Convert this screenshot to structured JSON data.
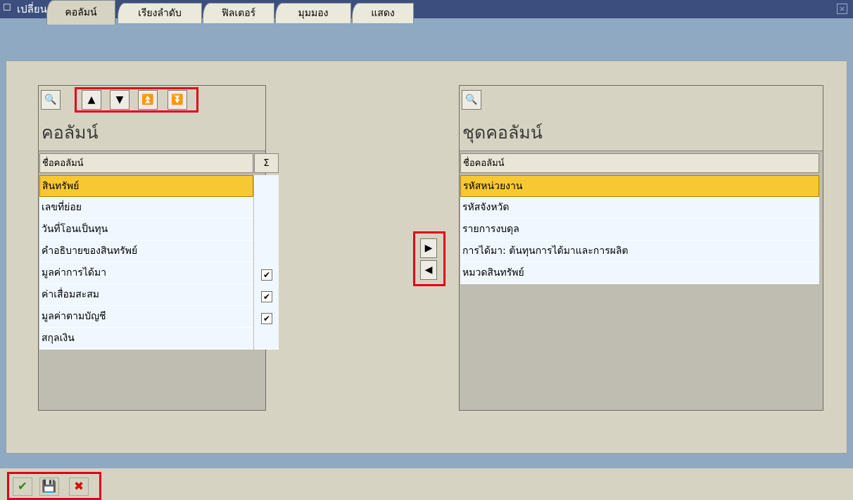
{
  "window": {
    "title": "เปลี่ยนแปลงโครงร่าง",
    "close_icon": "close-icon",
    "title_icon": "window-icon"
  },
  "tabs": [
    {
      "label": "คอลัมน์",
      "active": true
    },
    {
      "label": "เรียงลำดับ",
      "active": false
    },
    {
      "label": "ฟิลเตอร์",
      "active": false
    },
    {
      "label": "มุมมอง",
      "active": false
    },
    {
      "label": "แสดง",
      "active": false
    }
  ],
  "left_panel": {
    "title": "คอลัมน์",
    "toolbar": {
      "find": "find-icon",
      "up": "move-up-icon",
      "down": "move-down-icon",
      "top": "move-top-icon",
      "bottom": "move-bottom-icon"
    },
    "header": {
      "name": "ชื่อคอลัมน์",
      "sum_icon": "sigma-icon"
    },
    "rows": [
      {
        "name": "สินทรัพย์",
        "selected": true,
        "sum": false
      },
      {
        "name": "เลขที่ย่อย",
        "selected": false,
        "sum": false
      },
      {
        "name": "วันที่โอนเป็นทุน",
        "selected": false,
        "sum": false
      },
      {
        "name": "คำอธิบายของสินทรัพย์",
        "selected": false,
        "sum": false
      },
      {
        "name": "มูลค่าการได้มา",
        "selected": false,
        "sum": true
      },
      {
        "name": "ค่าเสื่อมสะสม",
        "selected": false,
        "sum": true
      },
      {
        "name": "มูลค่าตามบัญชี",
        "selected": false,
        "sum": true
      },
      {
        "name": "สกุลเงิน",
        "selected": false,
        "sum": false
      }
    ]
  },
  "transfer": {
    "add_icon": "arrow-right-icon",
    "remove_icon": "arrow-left-icon"
  },
  "right_panel": {
    "title": "ชุดคอลัมน์",
    "header": {
      "name": "ชื่อคอลัมน์"
    },
    "rows": [
      {
        "name": "รหัสหน่วยงาน",
        "selected": true
      },
      {
        "name": "รหัสจังหวัด",
        "selected": false
      },
      {
        "name": "รายการงบดุล",
        "selected": false
      },
      {
        "name": "การได้มา: ต้นทุนการได้มาและการผลิต",
        "selected": false
      },
      {
        "name": "หมวดสินทรัพย์",
        "selected": false
      }
    ]
  },
  "footer": {
    "ok_icon": "checkmark-icon",
    "save_icon": "save-icon",
    "cancel_icon": "cancel-icon"
  },
  "colors": {
    "title_bar": "#3c4e7e",
    "selection": "#f8c832",
    "highlight": "#e0001a",
    "background": "#d7d3c2"
  }
}
